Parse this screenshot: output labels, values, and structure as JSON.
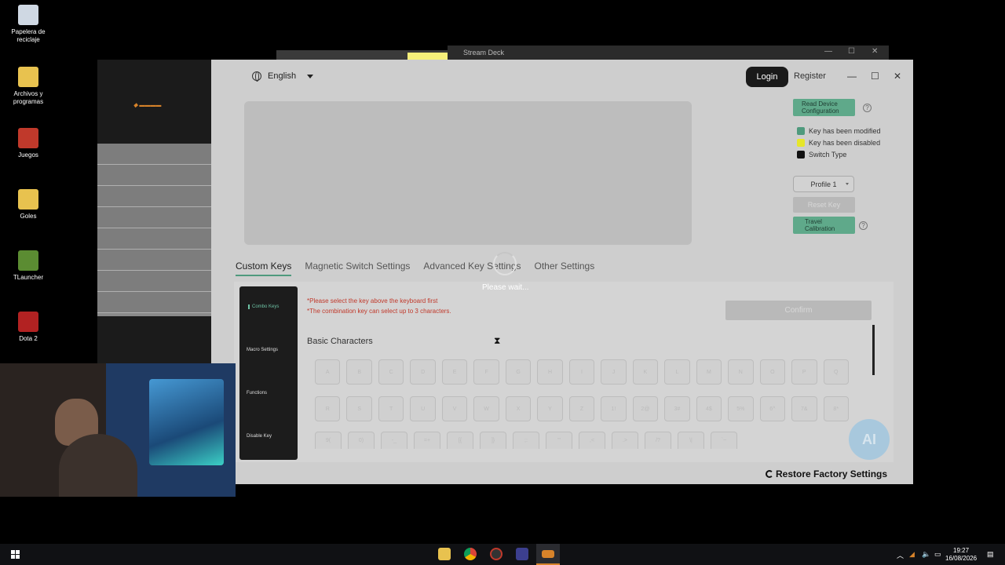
{
  "desktop": {
    "icons": [
      {
        "label": "Papelera de reciclaje",
        "icon": "recycle-bin-icon",
        "color": "#cfd8e3"
      },
      {
        "label": "Archivos y programas",
        "icon": "folder-icon",
        "color": "#e8c24f"
      },
      {
        "label": "Juegos",
        "icon": "games-folder-icon",
        "color": "#c0392b"
      },
      {
        "label": "Goles",
        "icon": "folder-icon",
        "color": "#e8c24f"
      },
      {
        "label": "TLauncher",
        "icon": "minecraft-block-icon",
        "color": "#5b8c32"
      },
      {
        "label": "Dota 2",
        "icon": "dota-icon",
        "color": "#b22222"
      }
    ]
  },
  "background_window": {
    "title": "Stream Deck"
  },
  "app": {
    "language": "English",
    "login_label": "Login",
    "register_label": "Register",
    "read_config_label": "Read Device Configuration",
    "legend": [
      {
        "label": "Key has been modified",
        "color": "#4f9a7d"
      },
      {
        "label": "Key has been disabled",
        "color": "#e6e62a"
      },
      {
        "label": "Switch Type",
        "color": "#111111"
      }
    ],
    "profile": "Profile 1",
    "reset_key_label": "Reset Key",
    "travel_calibration_label": "Travel Calibration",
    "tabs": [
      "Custom Keys",
      "Magnetic Switch Settings",
      "Advanced Key Settings",
      "Other Settings"
    ],
    "active_tab": "Custom Keys",
    "loading_text": "Please wait...",
    "submenu": [
      "Combo Keys",
      "Macro Settings",
      "Functions",
      "Disable Key"
    ],
    "notes": [
      "*Please select the key above the keyboard first",
      "*The combination key can select up to 3 characters."
    ],
    "confirm_label": "Confirm",
    "section_title": "Basic Characters",
    "key_rows": [
      [
        "A",
        "B",
        "C",
        "D",
        "E",
        "F",
        "G",
        "H",
        "I",
        "J",
        "K",
        "L",
        "M",
        "N",
        "O",
        "P",
        "Q"
      ],
      [
        "R",
        "S",
        "T",
        "U",
        "V",
        "W",
        "X",
        "Y",
        "Z",
        "1!",
        "2@",
        "3#",
        "4$",
        "5%",
        "6^",
        "7&",
        "8*"
      ],
      [
        "9(",
        "0)",
        "-_",
        "=+",
        "[{",
        "]}",
        ";:",
        "'\"",
        ",<",
        ".>",
        "/?",
        "\\|",
        "`~"
      ]
    ],
    "ai_badge": "AI",
    "restore_label": "Restore Factory Settings",
    "accent_color": "#5fa98a"
  },
  "taskbar": {
    "time": "19:27",
    "date": "16/08/2026"
  }
}
